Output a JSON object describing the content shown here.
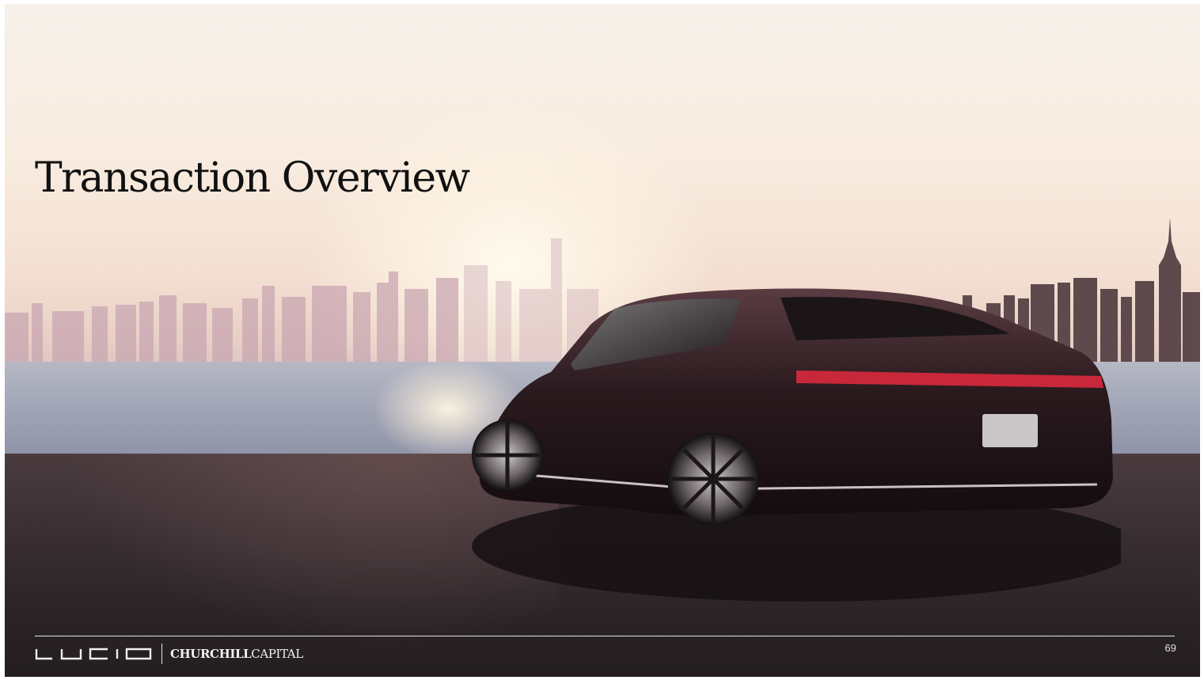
{
  "slide": {
    "title": "Transaction Overview",
    "page_number": "69"
  },
  "footer": {
    "brand_logo": "lucid-wordmark",
    "partner_name_bold": "CHURCHILL",
    "partner_name_regular": "CAPITAL"
  },
  "image": {
    "subject": "car-rear-three-quarter-view"
  },
  "colors": {
    "title": "#111111",
    "footer_text": "#f2f0f0",
    "ground": "#2b2427",
    "sky": "#f6f0ea"
  }
}
